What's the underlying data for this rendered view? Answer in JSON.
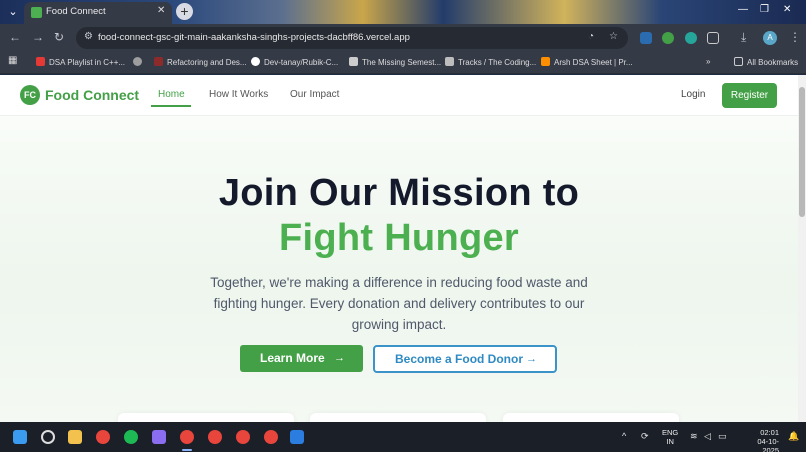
{
  "browser": {
    "tab_title": "Food Connect",
    "url": "food-connect-gsc-git-main-aakanksha-singhs-projects-dacbff86.vercel.app",
    "profile_initial": "A",
    "bookmarks": [
      {
        "label": "DSA Playlist in C++...",
        "color": "#e53935"
      },
      {
        "label": "",
        "color": "#9e9e9e"
      },
      {
        "label": "Refactoring and Des...",
        "color": "#8d2a2a"
      },
      {
        "label": "Dev-tanay/Rubik-C...",
        "color": "#ffffff"
      },
      {
        "label": "The Missing Semest...",
        "color": "#cccccc"
      },
      {
        "label": "Tracks / The Coding...",
        "color": "#bdbdbd"
      },
      {
        "label": "Arsh DSA Sheet | Pr...",
        "color": "#ff8f00"
      }
    ],
    "all_bookmarks": "All Bookmarks"
  },
  "site": {
    "logo_mark": "FC",
    "logo_text": "Food Connect",
    "nav": {
      "home": "Home",
      "how": "How It Works",
      "impact": "Our Impact"
    },
    "login": "Login",
    "register": "Register"
  },
  "hero": {
    "line1": "Join Our Mission to",
    "line2": "Fight Hunger",
    "subtitle": "Together, we're making a difference in reducing food waste and fighting hunger. Every donation and delivery contributes to our growing impact.",
    "cta_primary": "Learn More",
    "cta_secondary": "Become a Food Donor",
    "arrow": "→"
  },
  "taskbar": {
    "lang_top": "ENG",
    "lang_bottom": "IN",
    "time": "02:01",
    "date": "04-10-2025"
  },
  "colors": {
    "brand_green": "#43a047",
    "accent_blue": "#2f8ac2"
  }
}
